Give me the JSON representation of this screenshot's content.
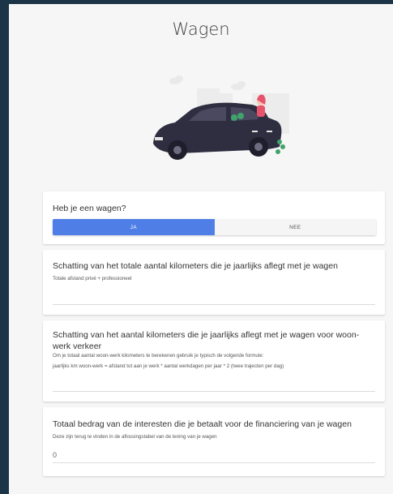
{
  "header": {
    "title": "Wagen"
  },
  "illustration": {
    "name": "car-with-person-illustration"
  },
  "questions": [
    {
      "label": "Heb je een wagen?",
      "options": [
        "JA",
        "NEE"
      ],
      "selected": "JA"
    },
    {
      "label": "Schatting van het totale aantal kilometers die je jaarlijks aflegt met je wagen",
      "hint": "Totale afstand privé + professioneel",
      "value": ""
    },
    {
      "label": "Schatting van het aantal kilometers die je jaarlijks aflegt met je wagen voor woon-werk verkeer",
      "hint_lines": [
        "Om je totaal aantal woon-werk kilometers te berekenen gebruik je typisch de volgende formule:",
        "jaarlijks km woon-werk = afstand tot aan je werk * aantal werkdagen per jaar * 2 (twee trajecten per dag)"
      ],
      "value": ""
    },
    {
      "label": "Totaal bedrag van de interesten die je betaalt voor de financiering van je wagen",
      "hint": "Deze zijn terug te vinden in de aflossingstabel van de lening van je wagen",
      "value": "0"
    }
  ],
  "colors": {
    "accent": "#4f7fe6",
    "frame": "#1c3447",
    "background": "#f6f6f6",
    "car": "#2f2e41",
    "person_hair": "#e8536b"
  }
}
